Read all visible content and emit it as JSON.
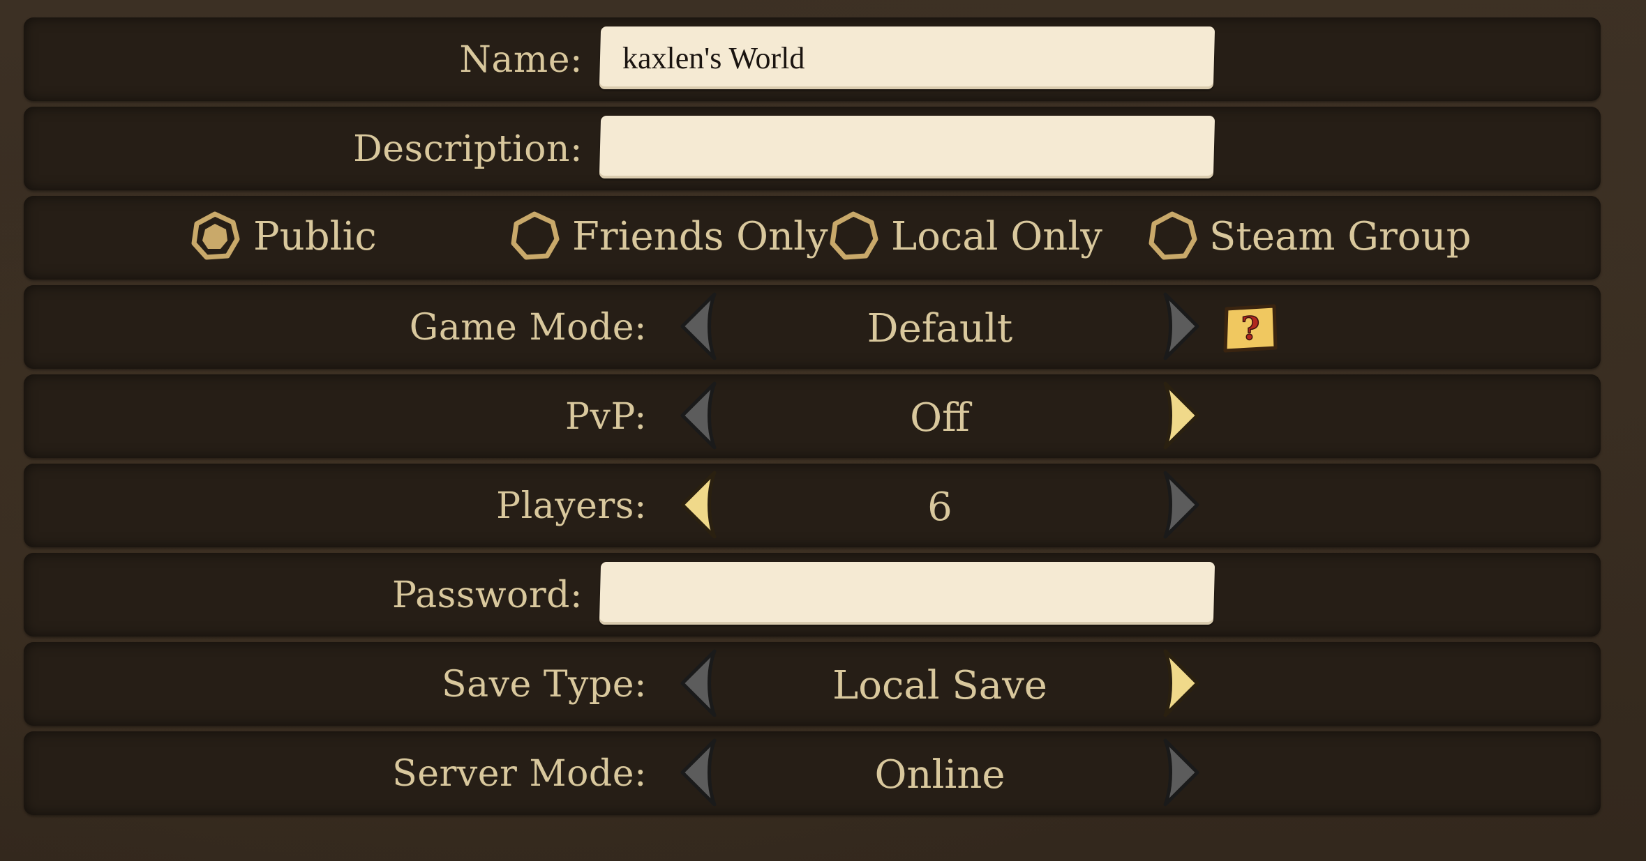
{
  "form": {
    "name": {
      "label": "Name:",
      "value": "kaxlen's World"
    },
    "description": {
      "label": "Description:",
      "value": ""
    },
    "visibility": {
      "selected": "Public",
      "options": [
        {
          "label": "Public",
          "selected": true
        },
        {
          "label": "Friends Only",
          "selected": false
        },
        {
          "label": "Local Only",
          "selected": false
        },
        {
          "label": "Steam Group",
          "selected": false
        }
      ]
    },
    "game_mode": {
      "label": "Game Mode:",
      "value": "Default",
      "help_icon": "question-mark-icon",
      "left_enabled": false,
      "right_enabled": false
    },
    "pvp": {
      "label": "PvP:",
      "value": "Off",
      "left_enabled": false,
      "right_enabled": true
    },
    "players": {
      "label": "Players:",
      "value": "6",
      "left_enabled": true,
      "right_enabled": false
    },
    "password": {
      "label": "Password:",
      "value": ""
    },
    "save_type": {
      "label": "Save Type:",
      "value": "Local Save",
      "left_enabled": false,
      "right_enabled": true
    },
    "server_mode": {
      "label": "Server Mode:",
      "value": "Online",
      "left_enabled": false,
      "right_enabled": false
    }
  },
  "colors": {
    "background": "#3a2e22",
    "row": "#261e16",
    "label_text": "#d9c89d",
    "input_bg": "#f5ead3",
    "arrow_active": "#f0d98a",
    "arrow_inactive": "#5a5a5a",
    "help_bg": "#f0c860",
    "help_glyph": "#b0281e"
  }
}
